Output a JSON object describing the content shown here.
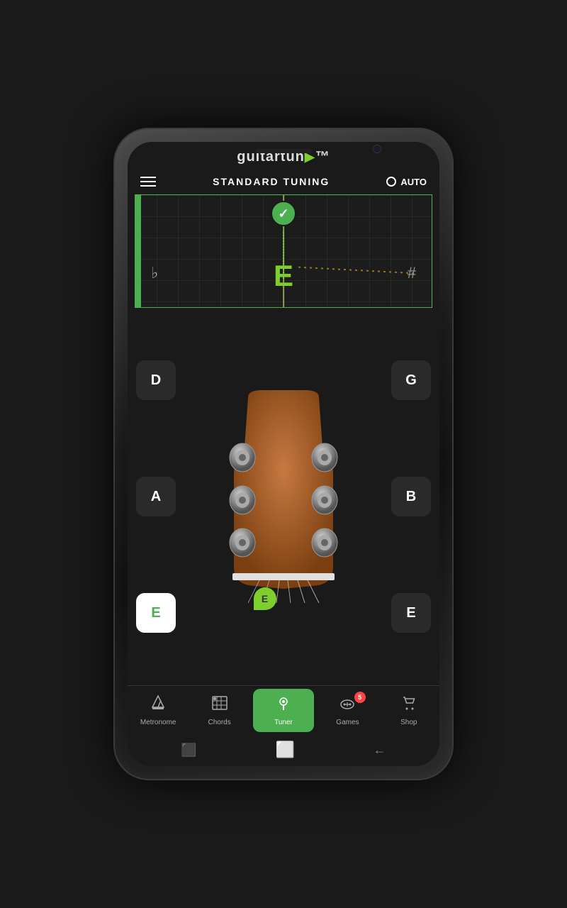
{
  "brand": {
    "name": "guitartun",
    "arrow": "▲",
    "trademark": "™"
  },
  "header": {
    "tuning_label": "STANDARD TUNING",
    "auto_label": "AUTO",
    "menu_label": "menu"
  },
  "tuner": {
    "note": "E",
    "flat_symbol": "♭",
    "sharp_symbol": "#",
    "in_tune": true
  },
  "strings": {
    "left": [
      {
        "note": "D",
        "active": false
      },
      {
        "note": "A",
        "active": false
      },
      {
        "note": "E",
        "active": true
      }
    ],
    "right": [
      {
        "note": "G",
        "active": false
      },
      {
        "note": "B",
        "active": false
      },
      {
        "note": "E",
        "active": false
      }
    ]
  },
  "string_indicator": {
    "note": "E"
  },
  "bottom_nav": {
    "items": [
      {
        "id": "metronome",
        "label": "Metronome",
        "icon": "🎵",
        "active": false,
        "badge": null
      },
      {
        "id": "chords",
        "label": "Chords",
        "icon": "🎸",
        "active": false,
        "badge": null
      },
      {
        "id": "tuner",
        "label": "Tuner",
        "icon": "📍",
        "active": true,
        "badge": null
      },
      {
        "id": "games",
        "label": "Games",
        "icon": "🎮",
        "active": false,
        "badge": "5"
      },
      {
        "id": "shop",
        "label": "Shop",
        "icon": "🛒",
        "active": false,
        "badge": null
      }
    ]
  },
  "android_nav": {
    "back": "←",
    "home": "⬜",
    "recent": "⬛"
  }
}
